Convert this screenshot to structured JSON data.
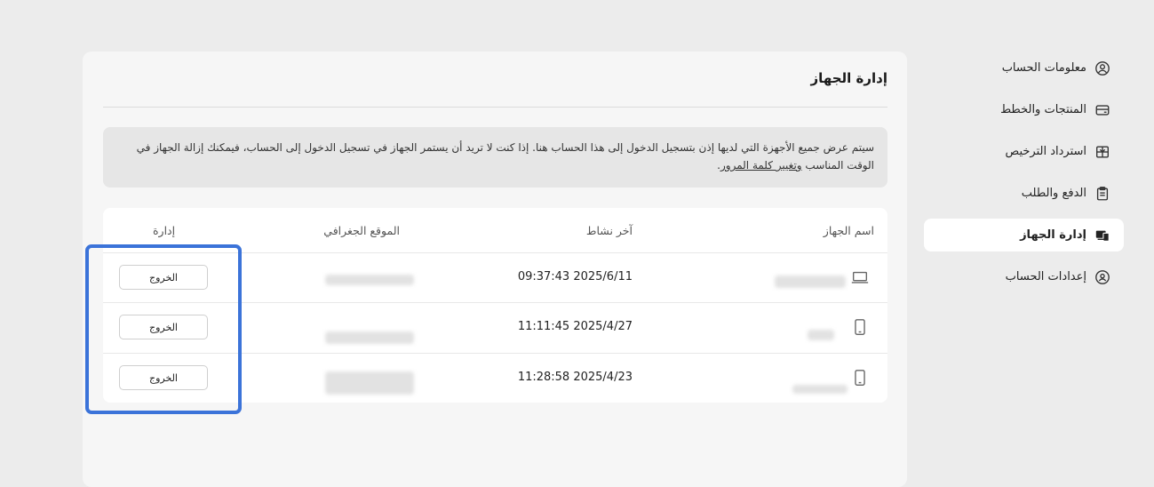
{
  "sidebar": {
    "items": [
      {
        "label": "معلومات الحساب",
        "icon": "user-circle-icon",
        "active": false
      },
      {
        "label": "المنتجات والخطط",
        "icon": "card-icon",
        "active": false
      },
      {
        "label": "استرداد الترخيص",
        "icon": "gift-icon",
        "active": false
      },
      {
        "label": "الدفع والطلب",
        "icon": "document-icon",
        "active": false
      },
      {
        "label": "إدارة الجهاز",
        "icon": "devices-icon",
        "active": true
      },
      {
        "label": "إعدادات الحساب",
        "icon": "user-shield-icon",
        "active": false
      }
    ]
  },
  "main": {
    "title": "إدارة الجهاز",
    "notice": {
      "text": "سيتم عرض جميع الأجهزة التي لديها إذن بتسجيل الدخول إلى هذا الحساب هنا. إذا كنت لا تريد أن يستمر الجهاز في تسجيل الدخول إلى الحساب، فيمكنك إزالة الجهاز في الوقت المناسب ",
      "link": "وتغيير كلمة المرور",
      "end": "."
    },
    "table": {
      "headers": {
        "device": "اسم الجهاز",
        "last_active": "آخر نشاط",
        "location": "الموقع الجغرافي",
        "manage": "إدارة"
      },
      "rows": [
        {
          "device_icon": "laptop-icon",
          "last_active": "09:37:43 2025/6/11",
          "button": "الخروج"
        },
        {
          "device_icon": "phone-icon",
          "last_active": "11:11:45 2025/4/27",
          "button": "الخروج"
        },
        {
          "device_icon": "phone-icon",
          "last_active": "11:28:58 2025/4/23",
          "button": "الخروج"
        }
      ]
    }
  },
  "colors": {
    "highlight": "#3b73d9",
    "page_bg": "#ececec",
    "panel_bg": "#f6f6f6"
  }
}
